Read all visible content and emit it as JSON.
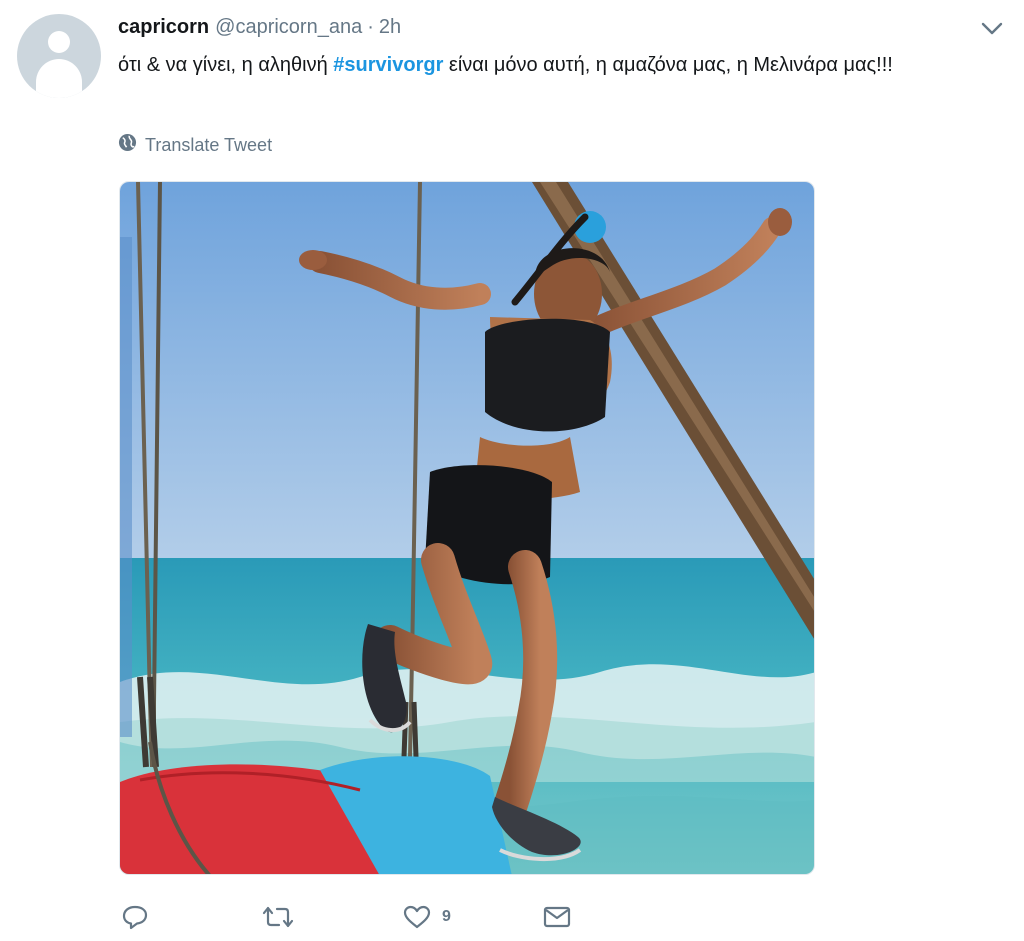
{
  "tweet": {
    "display_name": "capricorn",
    "handle": "@capricorn_ana",
    "separator": "·",
    "time": "2h",
    "text_before": "ότι & να γίνει, η αληθινή ",
    "hashtag": "#survivorgr",
    "text_after": " είναι μόνο αυτή, η αμαζόνα μας, η Μελινάρα μας!!!",
    "translate_label": "Translate Tweet"
  },
  "actions": {
    "reply_count": "",
    "retweet_count": "",
    "like_count": "9",
    "message_count": ""
  },
  "colors": {
    "link": "#1b95e0",
    "secondary": "#657786",
    "primary_text": "#14171a"
  },
  "icons": [
    "avatar-placeholder",
    "chevron-down-icon",
    "globe-icon",
    "reply-icon",
    "retweet-icon",
    "like-icon",
    "message-icon"
  ]
}
